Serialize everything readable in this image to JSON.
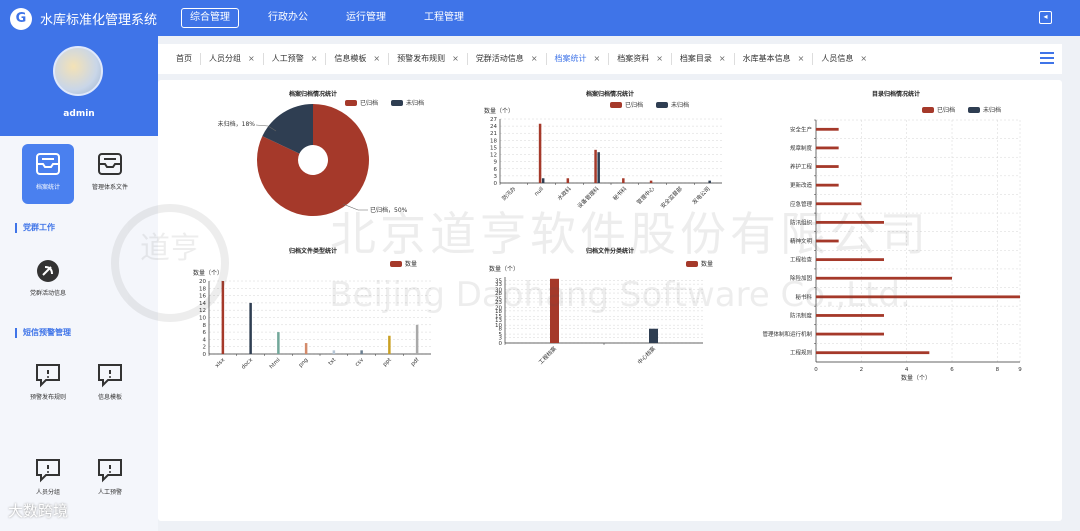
{
  "app": {
    "title": "水库标准化管理系统",
    "logo": "logo-icon"
  },
  "nav": [
    "综合管理",
    "行政办公",
    "运行管理",
    "工程管理"
  ],
  "nav_active": 0,
  "user": {
    "name": "admin"
  },
  "sidebar": {
    "top_items": [
      {
        "label": "档案统计",
        "icon": "tray-icon",
        "active": true
      },
      {
        "label": "管理体系文件",
        "icon": "tray-icon",
        "active": false
      }
    ],
    "section1": "党群工作",
    "section1_items": [
      {
        "label": "党群活动信息",
        "icon": "party-icon"
      }
    ],
    "section2": "短信预警管理",
    "section2_items": [
      {
        "label": "预警发布规则",
        "icon": "message-icon"
      },
      {
        "label": "信息模板",
        "icon": "message-icon"
      },
      {
        "label": "人员分组",
        "icon": "message-icon"
      },
      {
        "label": "人工预警",
        "icon": "message-icon"
      }
    ]
  },
  "tabs": [
    {
      "label": "首页",
      "closable": false
    },
    {
      "label": "人员分组",
      "closable": true
    },
    {
      "label": "人工预警",
      "closable": true
    },
    {
      "label": "信息模板",
      "closable": true
    },
    {
      "label": "预警发布规则",
      "closable": true
    },
    {
      "label": "党群活动信息",
      "closable": true
    },
    {
      "label": "档案统计",
      "closable": true,
      "active": true
    },
    {
      "label": "档案资料",
      "closable": true
    },
    {
      "label": "档案目录",
      "closable": true
    },
    {
      "label": "水库基本信息",
      "closable": true
    },
    {
      "label": "人员信息",
      "closable": true
    }
  ],
  "tab_close": "×",
  "watermark": {
    "cn": "北京道亨软件股份有限公司",
    "en": "Beijing Daohang Software Co.,Ltd.",
    "seal": "道亨"
  },
  "brand": "大数跨境",
  "colors": {
    "archived": "#a5392a",
    "unarchived": "#2f3e52",
    "primary": "#3f74e8"
  },
  "chart_data": [
    {
      "id": "pie",
      "type": "pie",
      "title": "档案归档情况统计",
      "legend": [
        "已归档",
        "未归档"
      ],
      "slices": [
        {
          "name": "已归档",
          "value": 82,
          "label": "已归档，50%"
        },
        {
          "name": "未归档",
          "value": 18,
          "label": "未归档，18%"
        }
      ],
      "legend_position": "top"
    },
    {
      "id": "bar1",
      "type": "bar",
      "title": "档案归档情况统计",
      "ylabel": "数量（个）",
      "legend": [
        "已归档",
        "未归档"
      ],
      "categories": [
        "防汛办",
        "null",
        "水政科",
        "设备管理科",
        "秘书科",
        "管理中心",
        "安全监督部",
        "发电公司"
      ],
      "series": [
        {
          "name": "已归档",
          "values": [
            0,
            25,
            2,
            14,
            2,
            1,
            0,
            0
          ]
        },
        {
          "name": "未归档",
          "values": [
            0,
            2,
            0,
            13,
            0,
            0,
            0,
            1
          ]
        }
      ],
      "yticks": [
        0,
        3,
        6,
        9,
        12,
        15,
        18,
        21,
        24,
        27
      ],
      "ylim": [
        0,
        27
      ]
    },
    {
      "id": "hbar",
      "type": "bar",
      "orientation": "horizontal",
      "title": "目录归档情况统计",
      "xlabel": "数量（个）",
      "legend": [
        "已归档",
        "未归档"
      ],
      "categories": [
        "安全生产",
        "规章制度",
        "养护工程",
        "更新改造",
        "应急管理",
        "防汛组织",
        "精神文明",
        "工程检查",
        "除险加固",
        "秘书科",
        "防汛制度",
        "管理体制和运行机制",
        "工程规则"
      ],
      "series": [
        {
          "name": "已归档",
          "values": [
            1,
            1,
            1,
            1,
            2,
            3,
            1,
            3,
            6,
            9,
            3,
            3,
            5
          ]
        },
        {
          "name": "未归档",
          "values": [
            0,
            0,
            0,
            0,
            0,
            0,
            0,
            0,
            0,
            0,
            0,
            0,
            0
          ]
        }
      ],
      "xticks": [
        0,
        2,
        4,
        6,
        8,
        9
      ],
      "xlim": [
        0,
        9
      ]
    },
    {
      "id": "bar2",
      "type": "bar",
      "title": "归档文件类型统计",
      "ylabel": "数量（个）",
      "legend": [
        "数量"
      ],
      "categories": [
        "xlsx",
        "docx",
        "html",
        "png",
        "txt",
        "csv",
        "ppt",
        "pdf"
      ],
      "series": [
        {
          "name": "数量",
          "values": [
            20,
            14,
            6,
            3,
            1,
            1,
            5,
            8
          ]
        }
      ],
      "bar_colors": [
        "#a5392a",
        "#2f3e52",
        "#72a89a",
        "#d38a6a",
        "#b6c6d6",
        "#6b7f91",
        "#c9a023",
        "#a9a9a9"
      ],
      "yticks": [
        0,
        2,
        4,
        6,
        8,
        10,
        12,
        14,
        16,
        18,
        20
      ],
      "ylim": [
        0,
        20
      ]
    },
    {
      "id": "bar3",
      "type": "bar",
      "title": "归档文件分类统计",
      "ylabel": "数量（个）",
      "legend": [
        "数量"
      ],
      "categories": [
        "工程档案",
        "中心档案"
      ],
      "series": [
        {
          "name": "数量",
          "values": [
            36,
            8
          ]
        }
      ],
      "bar_colors": [
        "#a5392a",
        "#2f3e52"
      ],
      "yticks": [
        0,
        3,
        5,
        8,
        10,
        13,
        15,
        18,
        20,
        23,
        25,
        28,
        30,
        33,
        35
      ],
      "ylim": [
        0,
        37
      ]
    }
  ]
}
